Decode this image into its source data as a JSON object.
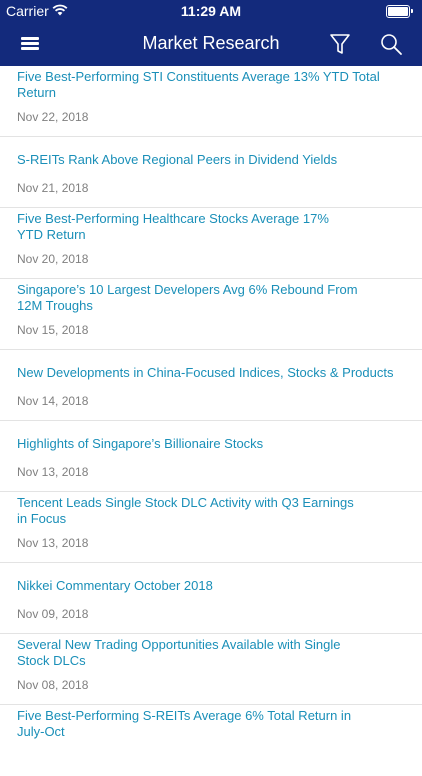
{
  "status_bar": {
    "carrier": "Carrier",
    "time": "11:29 AM",
    "icons": [
      "wifi-icon",
      "battery-icon"
    ]
  },
  "nav": {
    "title": "Market Research",
    "icons": [
      "menu-icon",
      "filter-icon",
      "search-icon"
    ]
  },
  "colors": {
    "header_background": "#132a7c",
    "title_link": "#1a8fb8",
    "date_text": "#808080",
    "divider": "#e3e3e3"
  },
  "articles": [
    {
      "title": "Five Best-Performing STI Constituents Average 13% YTD Total Return",
      "date": "Nov 22, 2018"
    },
    {
      "title": "S-REITs Rank Above Regional Peers in Dividend Yields",
      "date": "Nov 21, 2018"
    },
    {
      "title": "Five Best-Performing Healthcare Stocks Average 17% YTD Return",
      "date": "Nov 20, 2018"
    },
    {
      "title": "Singapore’s 10 Largest Developers Avg 6% Rebound From 12M Troughs",
      "date": "Nov 15, 2018"
    },
    {
      "title": "New Developments in China-Focused Indices, Stocks & Products",
      "date": "Nov 14, 2018"
    },
    {
      "title": "Highlights of Singapore’s Billionaire Stocks",
      "date": "Nov 13, 2018"
    },
    {
      "title": "Tencent Leads Single Stock DLC Activity with Q3 Earnings in Focus",
      "date": "Nov 13, 2018"
    },
    {
      "title": "Nikkei Commentary October 2018",
      "date": "Nov 09, 2018"
    },
    {
      "title": "Several New Trading Opportunities Available with Single Stock DLCs",
      "date": "Nov 08, 2018"
    },
    {
      "title": "Five Best-Performing S-REITs Average 6% Total Return in July-Oct",
      "date": ""
    }
  ]
}
